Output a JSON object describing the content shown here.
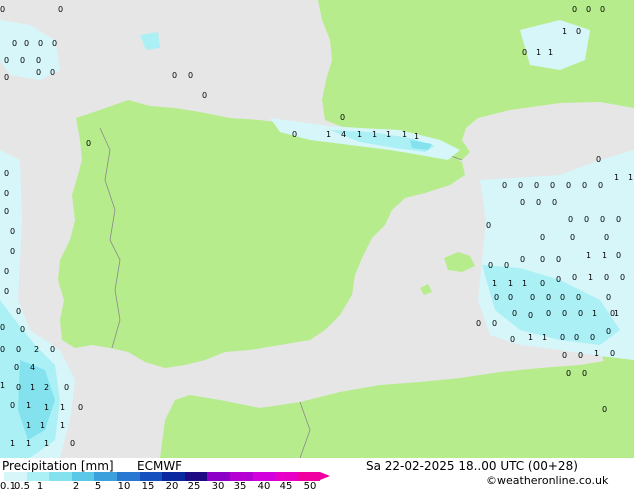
{
  "footer": {
    "title": "Precipitation [mm]",
    "model": "ECMWF",
    "datetime": "Sa 22-02-2025 18..00 UTC (00+28)",
    "copyright": "©weatheronline.co.uk"
  },
  "legend": {
    "ticks": [
      "0.1",
      "0.5",
      "1",
      "2",
      "5",
      "10",
      "15",
      "20",
      "25",
      "30",
      "35",
      "40",
      "45",
      "50"
    ],
    "colors": [
      "#d7f6fa",
      "#aaf0f5",
      "#84e2ef",
      "#5ac8e6",
      "#3ca0dc",
      "#2878d2",
      "#1450be",
      "#0a28a0",
      "#1e0a82",
      "#8c00c8",
      "#b400d2",
      "#d200dc",
      "#e600c8",
      "#f000a0"
    ]
  },
  "colors": {
    "sea": "#e6e6e6",
    "land": "#b7ec8c",
    "precip_light": "#d7f6fa",
    "precip_medium": "#aaf0f5",
    "precip_strong": "#84e2ef",
    "border": "#8a8a8a"
  },
  "markers": [
    "1",
    "2",
    "4",
    "0"
  ]
}
